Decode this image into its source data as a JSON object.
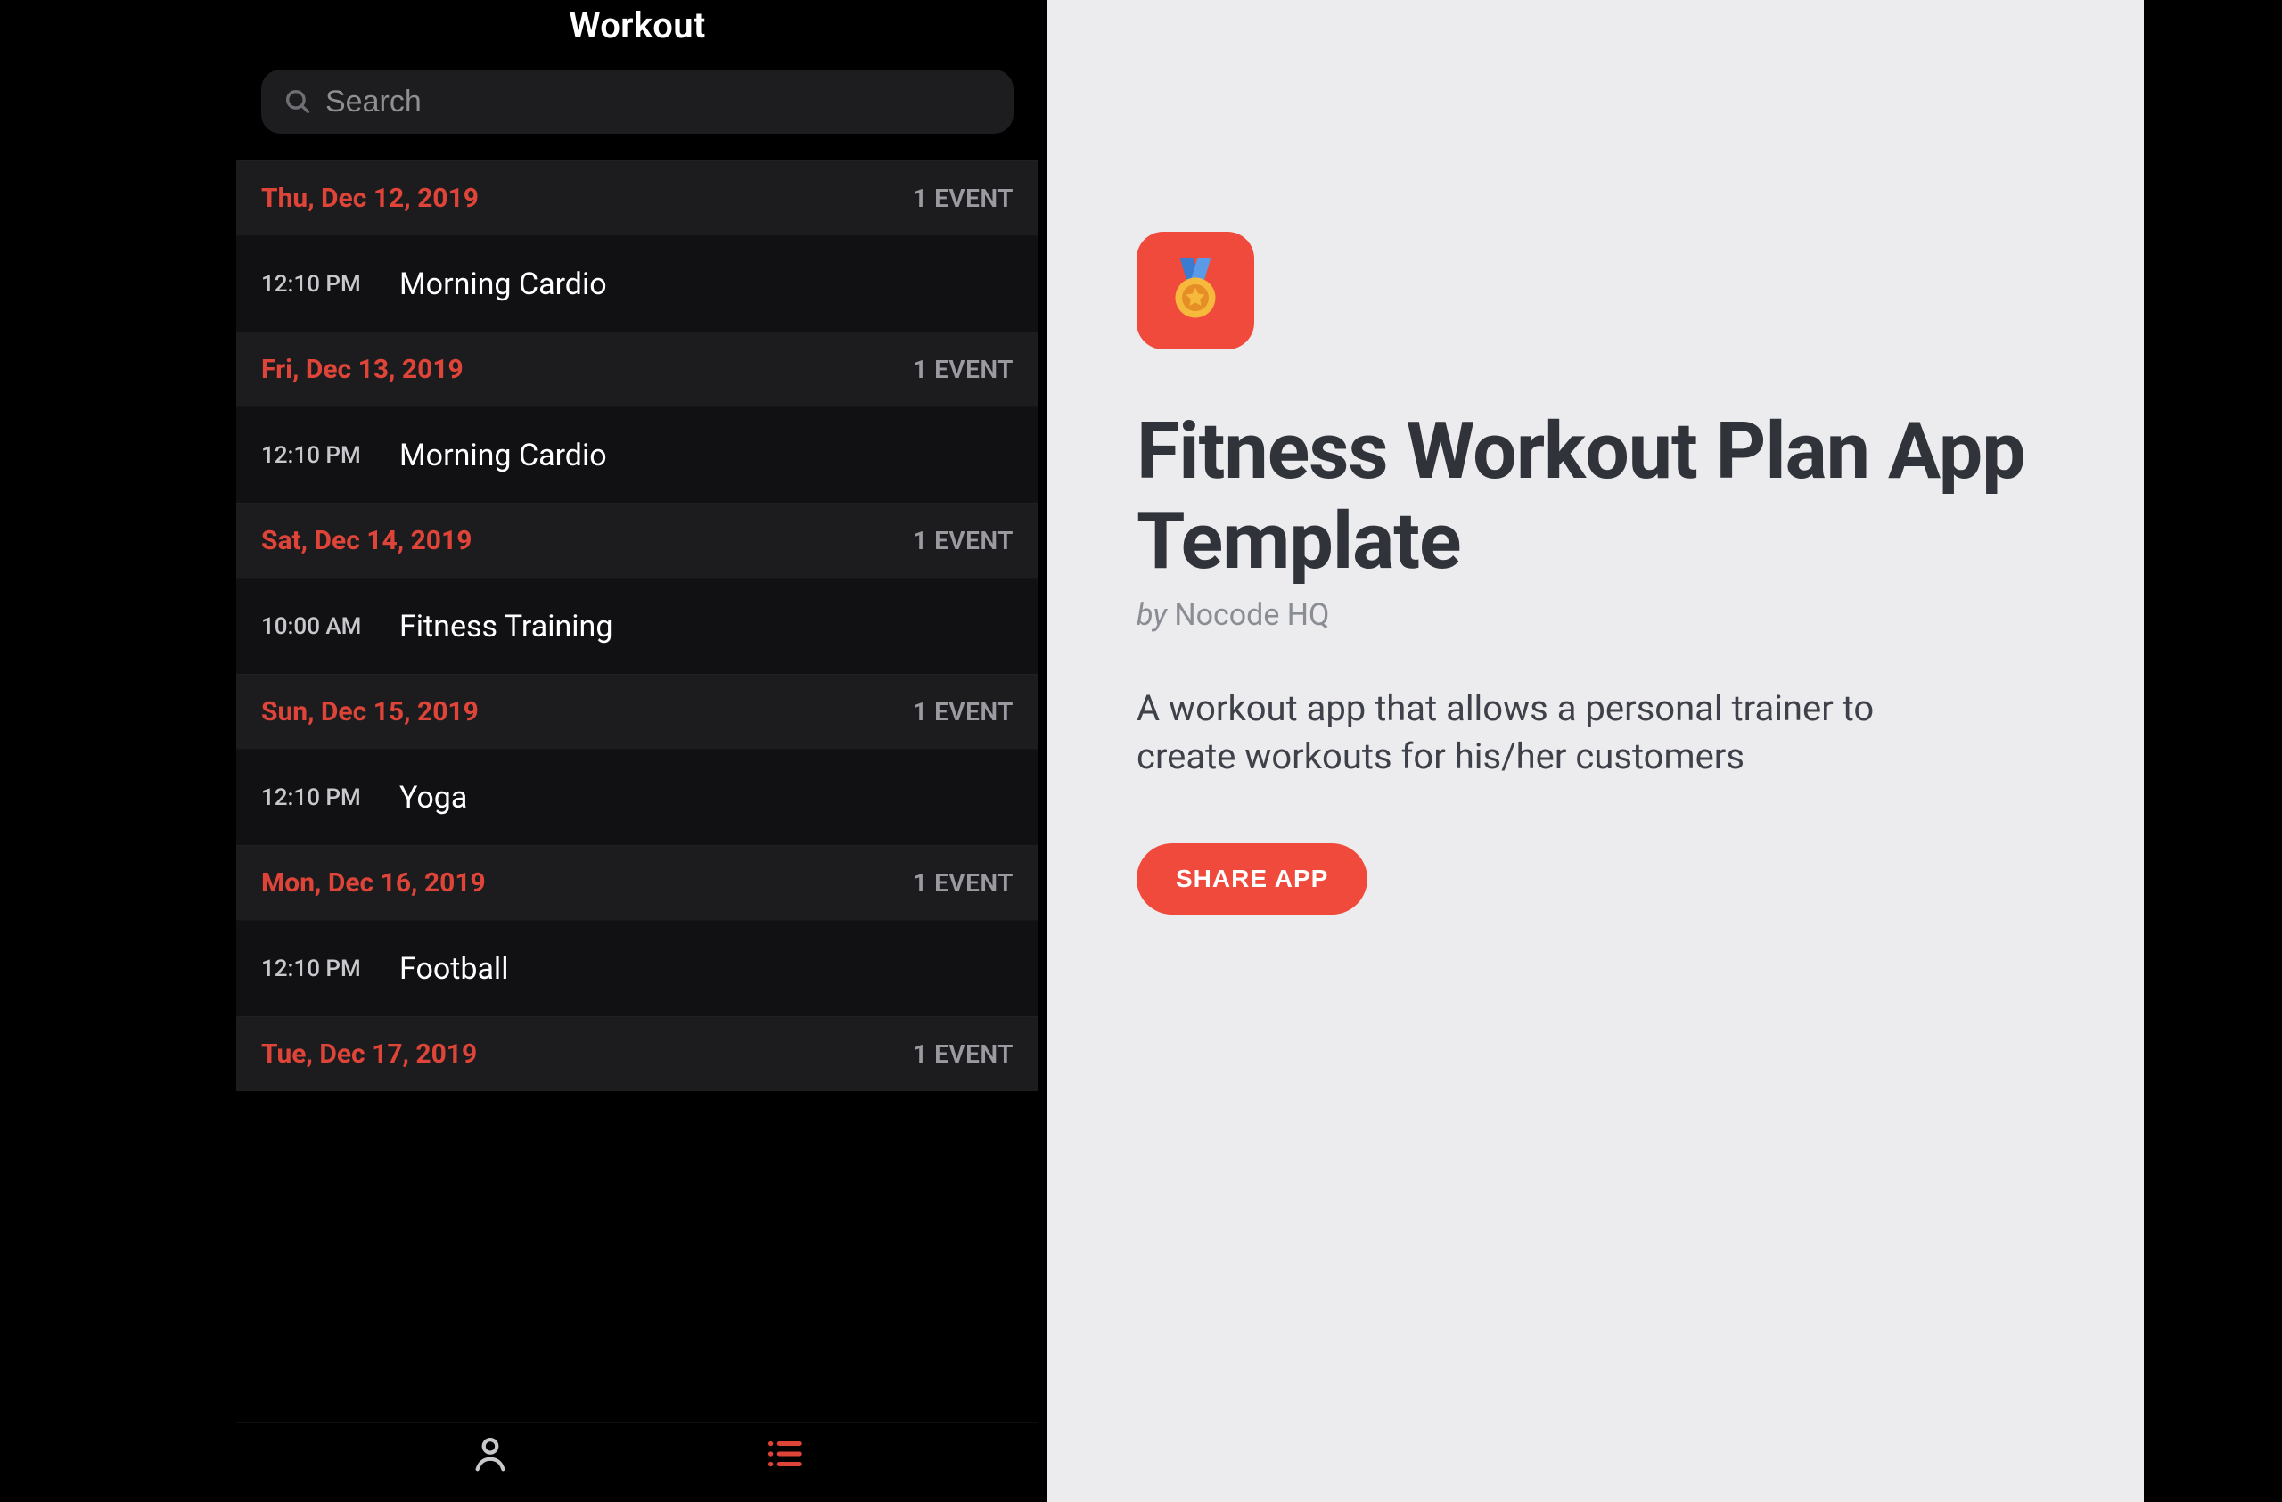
{
  "phone": {
    "title": "Workout",
    "search_placeholder": "Search",
    "days": [
      {
        "date": "Thu, Dec 12, 2019",
        "count_label": "1 EVENT",
        "events": [
          {
            "time": "12:10 PM",
            "name": "Morning Cardio"
          }
        ]
      },
      {
        "date": "Fri, Dec 13, 2019",
        "count_label": "1 EVENT",
        "events": [
          {
            "time": "12:10 PM",
            "name": "Morning Cardio"
          }
        ]
      },
      {
        "date": "Sat, Dec 14, 2019",
        "count_label": "1 EVENT",
        "events": [
          {
            "time": "10:00 AM",
            "name": "Fitness Training"
          }
        ]
      },
      {
        "date": "Sun, Dec 15, 2019",
        "count_label": "1 EVENT",
        "events": [
          {
            "time": "12:10 PM",
            "name": "Yoga"
          }
        ]
      },
      {
        "date": "Mon, Dec 16, 2019",
        "count_label": "1 EVENT",
        "events": [
          {
            "time": "12:10 PM",
            "name": "Football"
          }
        ]
      },
      {
        "date": "Tue, Dec 17, 2019",
        "count_label": "1 EVENT",
        "events": []
      }
    ],
    "tabs": {
      "profile_icon": "person-icon",
      "list_icon": "list-icon"
    }
  },
  "info": {
    "title": "Fitness Workout Plan App Template",
    "by_prefix": "by ",
    "author": "Nocode HQ",
    "description": "A workout app that allows a personal trainer to create workouts for his/her customers",
    "share_label": "SHARE APP"
  },
  "colors": {
    "accent": "#ef4a3b",
    "date_red": "#de4438",
    "bg_panel": "#ececee"
  }
}
